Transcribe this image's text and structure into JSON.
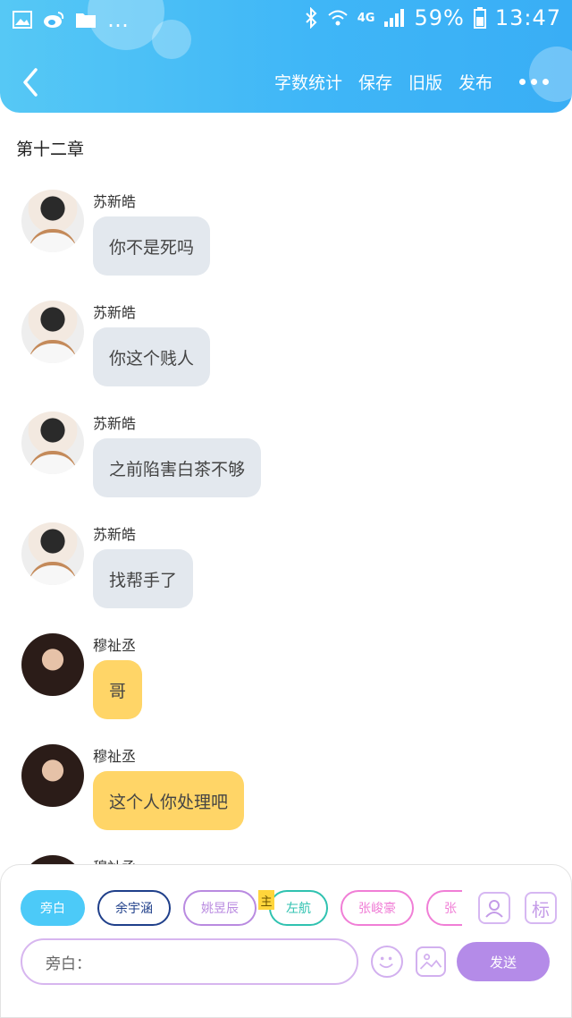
{
  "status_bar": {
    "battery": "59%",
    "time": "13:47",
    "network": "4G",
    "icons": [
      "image-icon",
      "weibo-icon",
      "folder-icon",
      "ellipsis-icon",
      "bluetooth-icon",
      "wifi-icon",
      "signal-icon",
      "battery-icon"
    ]
  },
  "header": {
    "back_icon": "chevron-left-icon",
    "actions": [
      "字数统计",
      "保存",
      "旧版",
      "发布"
    ],
    "more_icon": "more-dots-icon",
    "accent": "#3fb6f7"
  },
  "chapter_title": "第十二章",
  "messages": [
    {
      "sender": "苏新皓",
      "text": "你不是死吗",
      "style": "grey"
    },
    {
      "sender": "苏新皓",
      "text": "你这个贱人",
      "style": "grey"
    },
    {
      "sender": "苏新皓",
      "text": "之前陷害白茶不够",
      "style": "grey"
    },
    {
      "sender": "苏新皓",
      "text": "找帮手了",
      "style": "grey"
    },
    {
      "sender": "穆祉丞",
      "text": "哥",
      "style": "yellow"
    },
    {
      "sender": "穆祉丞",
      "text": "这个人你处理吧",
      "style": "yellow"
    },
    {
      "sender": "穆祉丞",
      "text": "",
      "style": "yellow"
    }
  ],
  "composer": {
    "roles": [
      {
        "name": "旁白",
        "color": "#4ccaf8",
        "active": true
      },
      {
        "name": "余宇涵",
        "color": "#1f3f8a",
        "active": false
      },
      {
        "name": "姚昱辰",
        "color": "#b98ae0",
        "active": false
      },
      {
        "name": "左航",
        "color": "#2fc2b0",
        "active": false
      },
      {
        "name": "张峻豪",
        "color": "#f07ed6",
        "active": false
      },
      {
        "name": "张",
        "color": "#f07ed6",
        "active": false
      }
    ],
    "main_tag": "主",
    "avatar_tool_icon": "person-icon",
    "label_tool": "标",
    "input_placeholder": "旁白：",
    "emoji_icon": "smile-icon",
    "image_icon": "image-icon",
    "send_label": "发送",
    "send_color": "#b48be8"
  }
}
